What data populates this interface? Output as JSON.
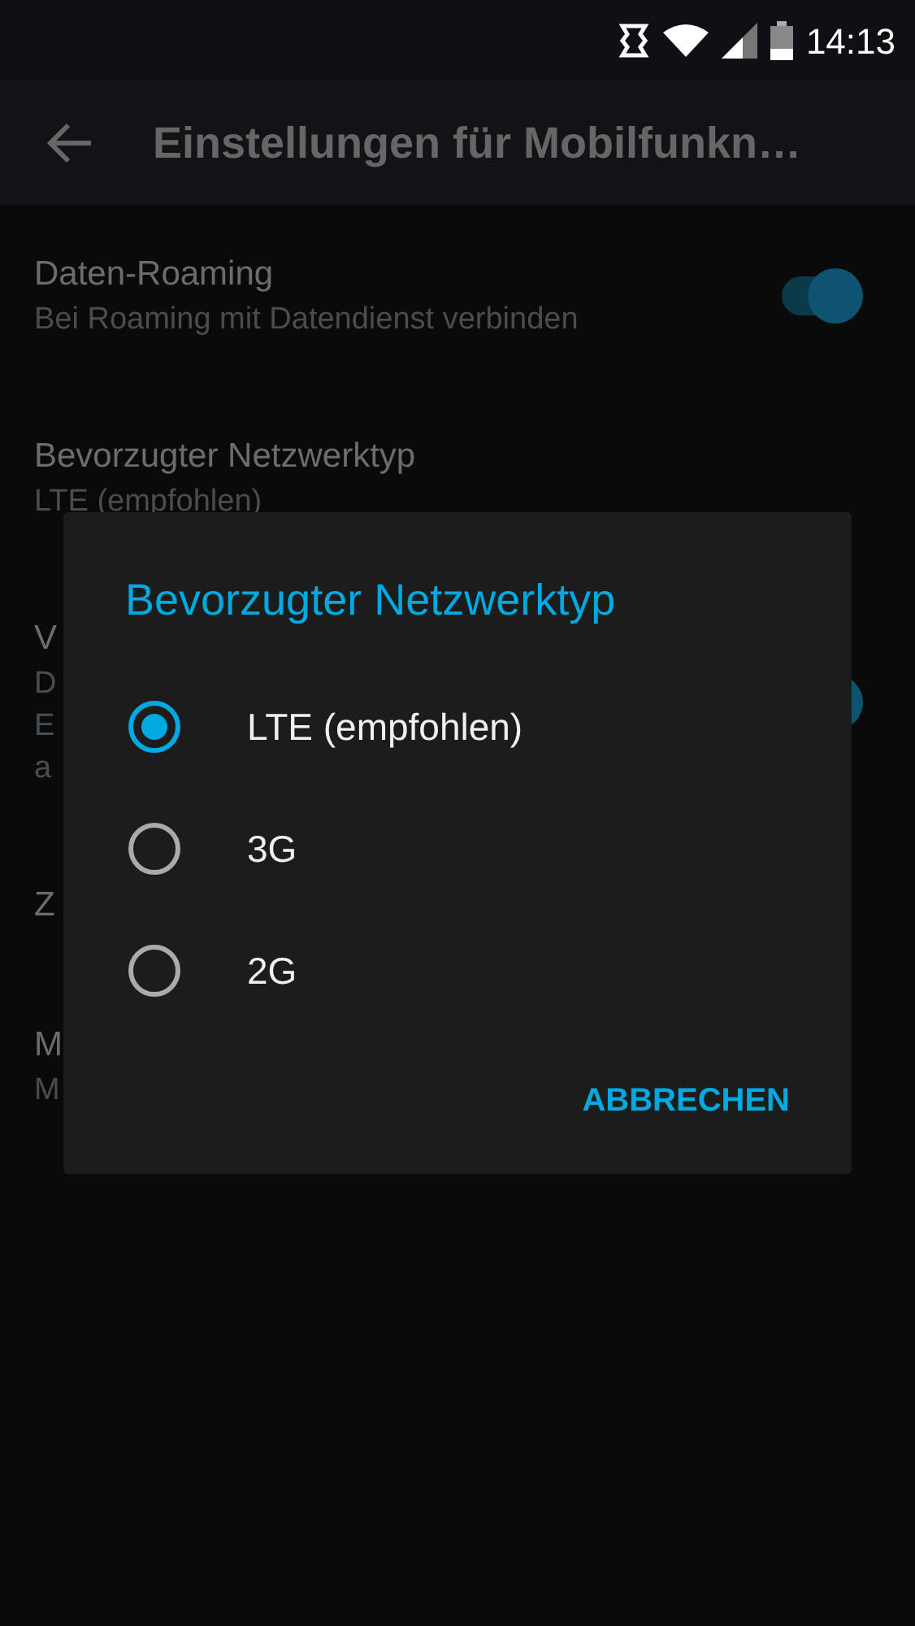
{
  "status_bar": {
    "time": "14:13"
  },
  "toolbar": {
    "title": "Einstellungen für Mobilfunkn…"
  },
  "settings": [
    {
      "kind": "switch",
      "title": "Daten-Roaming",
      "summary": [
        "Bei Roaming mit Datendienst verbinden"
      ],
      "on": true
    },
    {
      "kind": "text",
      "title": "Bevorzugter Netzwerktyp",
      "summary": [
        "LTE (empfohlen)"
      ]
    },
    {
      "kind": "switch",
      "title": "V",
      "summary": [
        "D",
        "E",
        "a"
      ],
      "on": true
    },
    {
      "kind": "text",
      "title": "Z"
    },
    {
      "kind": "text",
      "title": "M",
      "summary": [
        "M"
      ]
    }
  ],
  "dialog": {
    "title": "Bevorzugter Netzwerktyp",
    "options": [
      {
        "label": "LTE (empfohlen)",
        "selected": true
      },
      {
        "label": "3G",
        "selected": false
      },
      {
        "label": "2G",
        "selected": false
      }
    ],
    "buttons": [
      "ABBRECHEN"
    ]
  }
}
